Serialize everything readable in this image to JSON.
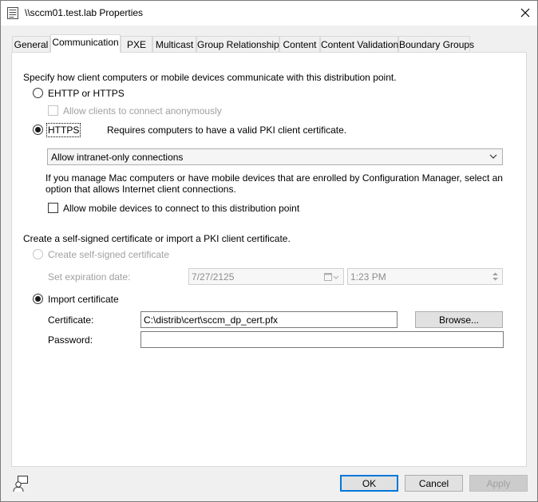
{
  "window": {
    "title": "\\\\sccm01.test.lab Properties",
    "close_icon": "close-icon"
  },
  "tabs": [
    {
      "label": "General"
    },
    {
      "label": "Communication",
      "active": true
    },
    {
      "label": "PXE"
    },
    {
      "label": "Multicast"
    },
    {
      "label": "Group Relationships"
    },
    {
      "label": "Content"
    },
    {
      "label": "Content Validation"
    },
    {
      "label": "Boundary Groups"
    }
  ],
  "communication": {
    "intro": "Specify how client computers or mobile devices communicate with this distribution point.",
    "ehttp_label": "EHTTP or HTTPS",
    "allow_anonymous_label": "Allow clients to connect anonymously",
    "https_label": "HTTPS",
    "https_desc": "Requires computers to have a valid PKI client certificate.",
    "connection_select": "Allow intranet-only connections",
    "mac_info": "If you manage Mac computers or have mobile devices that are enrolled by Configuration Manager, select an option that allows Internet client connections.",
    "mobile_label": "Allow mobile devices to connect to this distribution point"
  },
  "certificate": {
    "intro": "Create a self-signed certificate or import a PKI client certificate.",
    "self_signed_label": "Create self-signed certificate",
    "expiration_label": "Set expiration date:",
    "expiration_date": "7/27/2125",
    "expiration_time": "1:23 PM",
    "import_label": "Import certificate",
    "certificate_label": "Certificate:",
    "certificate_value": "C:\\distrib\\cert\\sccm_dp_cert.pfx",
    "browse_label": "Browse...",
    "password_label": "Password:",
    "password_value": ""
  },
  "footer": {
    "ok_label": "OK",
    "cancel_label": "Cancel",
    "apply_label": "Apply"
  },
  "colors": {
    "accent": "#0078d7",
    "disabled_text": "#a0a0a0"
  }
}
